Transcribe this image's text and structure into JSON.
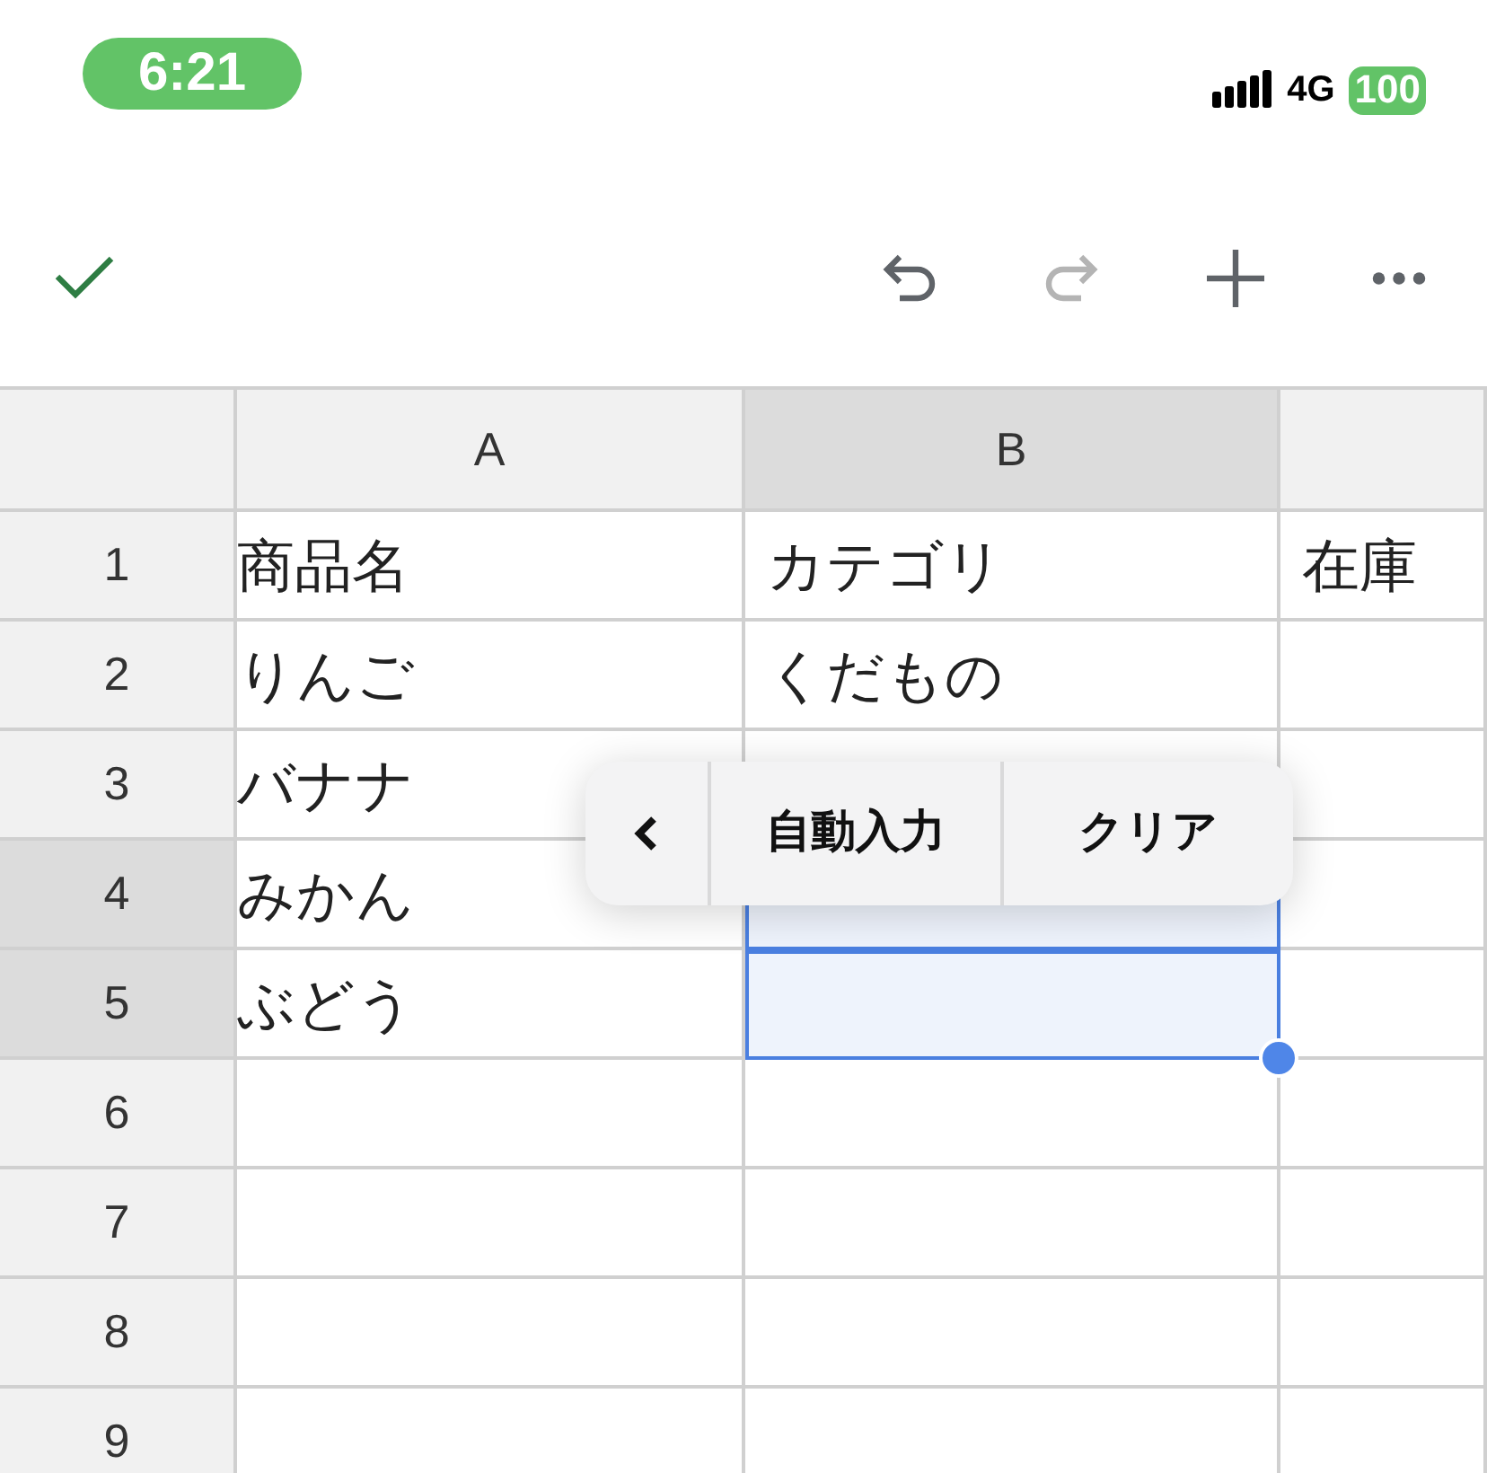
{
  "status_bar": {
    "time": "6:21",
    "network": "4G",
    "battery": "100"
  },
  "toolbar": [
    {
      "kind": "confirm",
      "disabled": false
    },
    {
      "kind": "undo",
      "disabled": false
    },
    {
      "kind": "redo",
      "disabled": true
    },
    {
      "kind": "add",
      "disabled": false
    },
    {
      "kind": "more",
      "disabled": false
    }
  ],
  "columns": [
    {
      "label": "A",
      "selected": false
    },
    {
      "label": "B",
      "selected": true
    },
    {
      "selected": false
    }
  ],
  "rows": [
    {
      "number": "1",
      "selected": false,
      "cells": [
        {
          "text": "商品名",
          "selected": false
        },
        {
          "text": "カテゴリ",
          "selected": false
        },
        {
          "text": "在庫",
          "selected": false
        }
      ]
    },
    {
      "number": "2",
      "selected": false,
      "cells": [
        {
          "text": "りんご",
          "selected": false
        },
        {
          "text": "くだもの",
          "selected": false
        },
        {
          "selected": false
        }
      ]
    },
    {
      "number": "3",
      "selected": false,
      "cells": [
        {
          "text": "バナナ",
          "selected": false
        },
        {
          "selected": false
        },
        {
          "selected": false
        }
      ]
    },
    {
      "number": "4",
      "selected": true,
      "cells": [
        {
          "text": "みかん",
          "selected": false
        },
        {
          "selected": true
        },
        {
          "selected": false
        }
      ]
    },
    {
      "number": "5",
      "selected": true,
      "cells": [
        {
          "text": "ぶどう",
          "selected": false
        },
        {
          "selected": true
        },
        {
          "selected": false
        }
      ]
    },
    {
      "number": "6",
      "selected": false,
      "cells": [
        {
          "selected": false
        },
        {
          "selected": false
        },
        {
          "selected": false
        }
      ]
    },
    {
      "number": "7",
      "selected": false,
      "cells": [
        {
          "selected": false
        },
        {
          "selected": false
        },
        {
          "selected": false
        }
      ]
    },
    {
      "number": "8",
      "selected": false,
      "cells": [
        {
          "selected": false
        },
        {
          "selected": false
        },
        {
          "selected": false
        }
      ]
    },
    {
      "number": "9",
      "selected": false,
      "cells": [
        {
          "selected": false
        },
        {
          "selected": false
        },
        {
          "selected": false
        }
      ]
    }
  ],
  "context_menu": {
    "items": [
      {
        "kind": "back"
      },
      {
        "kind": "action",
        "label": "自動入力"
      },
      {
        "kind": "action",
        "label": "クリア"
      }
    ]
  }
}
